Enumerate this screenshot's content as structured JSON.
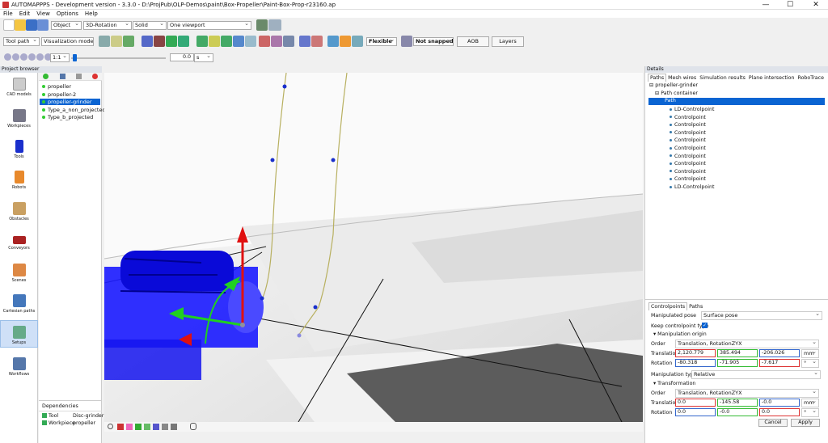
{
  "window": {
    "title": "AUTOMAPPPS - Development version - 3.3.0 - D:\\ProjPub\\OLP-Demos\\paint\\Box-Propeller\\Paint-Box-Prop-r23160.ap",
    "minimize": "—",
    "maximize": "☐",
    "close": "✕"
  },
  "menu": [
    "File",
    "Edit",
    "View",
    "Options",
    "Help"
  ],
  "toolbar1": {
    "mode_select": "Object",
    "rotation_select": "3D-Rotation",
    "render_select": "Solid",
    "viewport_select": "One viewport"
  },
  "toolbar2": {
    "toolpath_select": "Tool path",
    "vismodel_select": "Visualization model",
    "flexible_label": "Flexible",
    "snap_label": "Not snapped",
    "aob_label": "AOB",
    "layers_label": "Layers"
  },
  "toolbar3": {
    "speed_select": "1:1",
    "time_value": "0.0",
    "time_unit": "s",
    "slider_fraction": 0.02
  },
  "left_panel": {
    "header": "Project browser",
    "items": [
      "CAD models",
      "Workpieces",
      "Tools",
      "Robots",
      "Obstacles",
      "Conveyors",
      "Scenes",
      "Cartesian paths",
      "Setups",
      "Workflows"
    ]
  },
  "tree": {
    "items": [
      "propeller",
      "propeller-2",
      "propeller-grinder",
      "Type_a_non_projected",
      "Type_b_projected"
    ],
    "selected": "propeller-grinder"
  },
  "dependencies": {
    "header": "Dependencies",
    "rows": [
      {
        "key": "Tool",
        "value": "Disc-grinder"
      },
      {
        "key": "Workpiece",
        "value": "propeller"
      }
    ]
  },
  "details": {
    "header": "Details",
    "tabs": [
      "Paths",
      "Mesh wires",
      "Simulation results",
      "Plane intersection",
      "RoboTrace"
    ],
    "root": "propeller-grinder",
    "container": "Path container",
    "path": "Path",
    "points": [
      "LD-Controlpoint",
      "Controlpoint",
      "Controlpoint",
      "Controlpoint",
      "Controlpoint",
      "Controlpoint",
      "Controlpoint",
      "Controlpoint",
      "Controlpoint",
      "Controlpoint",
      "LD-Controlpoint"
    ],
    "subtabs": [
      "Controlpoints",
      "Paths"
    ],
    "manipulated_pose_label": "Manipulated pose",
    "manipulated_pose": "Surface pose",
    "keep_type_label": "Keep controlpoint type",
    "origin_section": "Manipulation origin",
    "order_label": "Order",
    "order_value": "Translation, RotationZYX",
    "translation_label": "Translation",
    "rotation_label": "Rotation",
    "origin_translation": [
      "2,120.779",
      "385.494",
      "-206.026"
    ],
    "origin_rotation": [
      "-80.318",
      "-71.905",
      "-7.617"
    ],
    "unit_mm": "mm",
    "unit_deg": "°",
    "manip_type_label": "Manipulation type",
    "manip_type": "Relative",
    "transform_section": "Transformation",
    "transform_order": "Translation, RotationZYX",
    "transform_translation": [
      "0.0",
      "-145.58",
      "-0.0"
    ],
    "transform_rotation": [
      "0.0",
      "-0.0",
      "0.0"
    ],
    "cancel": "Cancel",
    "apply": "Apply"
  },
  "colors": {
    "selection": "#0a64d2",
    "robot_blue": "#1a1aff",
    "path_line": "#b8b060",
    "point": "#1a2fcc",
    "axis_red": "#e01010",
    "axis_green": "#20d020"
  }
}
